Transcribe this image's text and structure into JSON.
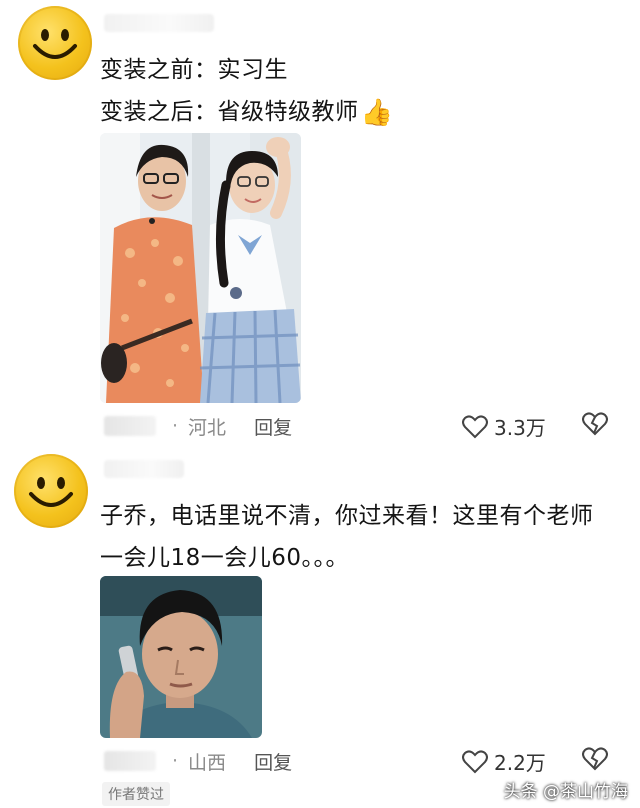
{
  "comments": [
    {
      "avatar_icon": "smiley-face-icon",
      "lines": [
        "变装之前：实习生",
        "变装之后：省级特级教师"
      ],
      "emoji": "👍",
      "location": "河北",
      "reply_label": "回复",
      "likes": "3.3万"
    },
    {
      "avatar_icon": "smiley-face-icon",
      "lines": [
        "子乔，电话里说不清，你过来看！这里有个老师",
        "一会儿18一会儿60。。。"
      ],
      "location": "山西",
      "reply_label": "回复",
      "likes": "2.2万",
      "badge": "作者赞过"
    }
  ],
  "watermark": "头条 @茶山竹海",
  "colors": {
    "avatar_yellow": "#f4c21d",
    "meta_gray": "#8a8a8a",
    "uniform_blue": "#7fa5d4"
  }
}
